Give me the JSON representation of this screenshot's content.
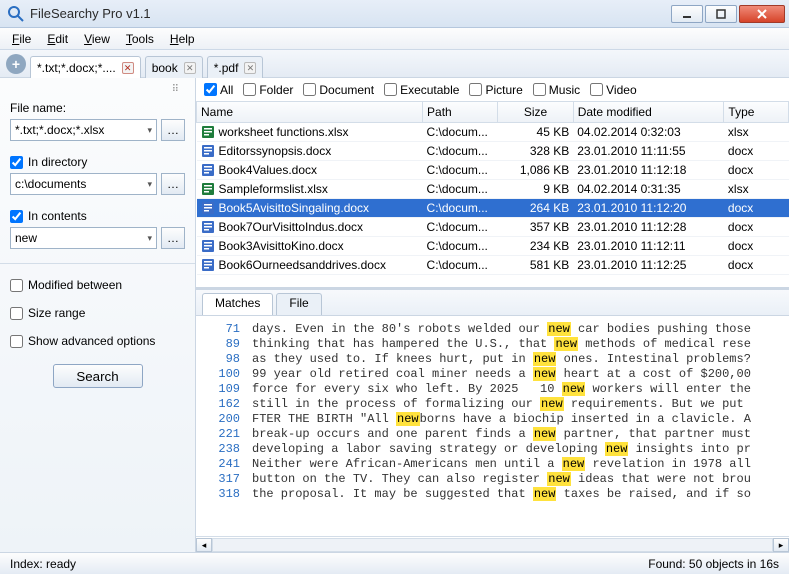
{
  "window": {
    "title": "FileSearchy Pro v1.1"
  },
  "menu": {
    "file": "File",
    "edit": "Edit",
    "view": "View",
    "tools": "Tools",
    "help": "Help"
  },
  "tabs": [
    {
      "label": "*.txt;*.docx;*....",
      "active": true
    },
    {
      "label": "book",
      "active": false
    },
    {
      "label": "*.pdf",
      "active": false
    }
  ],
  "sidebar": {
    "filename_label": "File name:",
    "filename_value": "*.txt;*.docx;*.xlsx",
    "in_directory_label": "In directory",
    "in_directory_checked": true,
    "directory_value": "c:\\documents",
    "in_contents_label": "In contents",
    "in_contents_checked": true,
    "contents_value": "new",
    "modified_label": "Modified between",
    "size_range_label": "Size range",
    "advanced_label": "Show advanced options",
    "search_label": "Search"
  },
  "filters": {
    "all": "All",
    "all_checked": true,
    "folder": "Folder",
    "document": "Document",
    "executable": "Executable",
    "picture": "Picture",
    "music": "Music",
    "video": "Video"
  },
  "columns": {
    "name": "Name",
    "path": "Path",
    "size": "Size",
    "date": "Date modified",
    "type": "Type"
  },
  "rows": [
    {
      "icon": "xls",
      "name": "worksheet functions.xlsx",
      "path": "C:\\docum...",
      "size": "45 KB",
      "date": "04.02.2014 0:32:03",
      "type": "xlsx"
    },
    {
      "icon": "doc",
      "name": "Editorssynopsis.docx",
      "path": "C:\\docum...",
      "size": "328 KB",
      "date": "23.01.2010 11:11:55",
      "type": "docx"
    },
    {
      "icon": "doc",
      "name": "Book4Values.docx",
      "path": "C:\\docum...",
      "size": "1,086 KB",
      "date": "23.01.2010 11:12:18",
      "type": "docx"
    },
    {
      "icon": "xls",
      "name": "Sampleformslist.xlsx",
      "path": "C:\\docum...",
      "size": "9 KB",
      "date": "04.02.2014 0:31:35",
      "type": "xlsx"
    },
    {
      "icon": "doc",
      "name": "Book5AvisittoSingaling.docx",
      "path": "C:\\docum...",
      "size": "264 KB",
      "date": "23.01.2010 11:12:20",
      "type": "docx",
      "selected": true
    },
    {
      "icon": "doc",
      "name": "Book7OurVisittoIndus.docx",
      "path": "C:\\docum...",
      "size": "357 KB",
      "date": "23.01.2010 11:12:28",
      "type": "docx"
    },
    {
      "icon": "doc",
      "name": "Book3AvisittoKino.docx",
      "path": "C:\\docum...",
      "size": "234 KB",
      "date": "23.01.2010 11:12:11",
      "type": "docx"
    },
    {
      "icon": "doc",
      "name": "Book6Ourneedsanddrives.docx",
      "path": "C:\\docum...",
      "size": "581 KB",
      "date": "23.01.2010 11:12:25",
      "type": "docx"
    }
  ],
  "preview_tabs": {
    "matches": "Matches",
    "file": "File"
  },
  "matches": [
    {
      "ln": 71,
      "pre": "days. Even in the 80's robots welded our ",
      "hl": "new",
      "post": " car bodies pushing those"
    },
    {
      "ln": 89,
      "pre": "thinking that has hampered the U.S., that ",
      "hl": "new",
      "post": " methods of medical rese"
    },
    {
      "ln": 98,
      "pre": "as they used to. If knees hurt, put in ",
      "hl": "new",
      "post": " ones. Intestinal problems?"
    },
    {
      "ln": 100,
      "pre": "99 year old retired coal miner needs a ",
      "hl": "new",
      "post": " heart at a cost of $200,00"
    },
    {
      "ln": 109,
      "pre": "force for every six who left. By 2025   10 ",
      "hl": "new",
      "post": " workers will enter the"
    },
    {
      "ln": 162,
      "pre": "still in the process of formalizing our ",
      "hl": "new",
      "post": " requirements. But we put "
    },
    {
      "ln": 200,
      "pre": "FTER THE BIRTH \"All ",
      "hl": "new",
      "post": "borns have a biochip inserted in a clavicle. A"
    },
    {
      "ln": 221,
      "pre": "break-up occurs and one parent finds a ",
      "hl": "new",
      "post": " partner, that partner must"
    },
    {
      "ln": 238,
      "pre": "developing a labor saving strategy or developing ",
      "hl": "new",
      "post": " insights into pr"
    },
    {
      "ln": 241,
      "pre": "Neither were African-Americans men until a ",
      "hl": "new",
      "post": " revelation in 1978 all"
    },
    {
      "ln": 317,
      "pre": "button on the TV. They can also register ",
      "hl": "new",
      "post": " ideas that were not brou"
    },
    {
      "ln": 318,
      "pre": "the proposal. It may be suggested that ",
      "hl": "new",
      "post": " taxes be raised, and if so"
    }
  ],
  "status": {
    "left": "Index: ready",
    "right": "Found: 50 objects in 16s"
  }
}
